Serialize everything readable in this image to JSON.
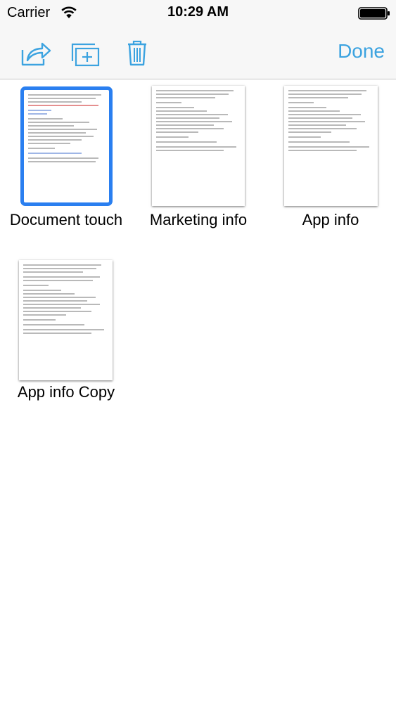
{
  "status_bar": {
    "carrier": "Carrier",
    "time": "10:29 AM"
  },
  "toolbar": {
    "share_icon": "share-icon",
    "new_folder_icon": "new-folder-icon",
    "trash_icon": "trash-icon",
    "done_label": "Done",
    "accent_color": "#3ca3e0"
  },
  "documents": [
    {
      "title": "Document touch",
      "selected": true
    },
    {
      "title": "Marketing info",
      "selected": false
    },
    {
      "title": "App info",
      "selected": false
    },
    {
      "title": "App info Copy",
      "selected": false
    }
  ],
  "colors": {
    "selection": "#2a7ff0",
    "background": "#ffffff",
    "bar": "#f7f7f7"
  }
}
